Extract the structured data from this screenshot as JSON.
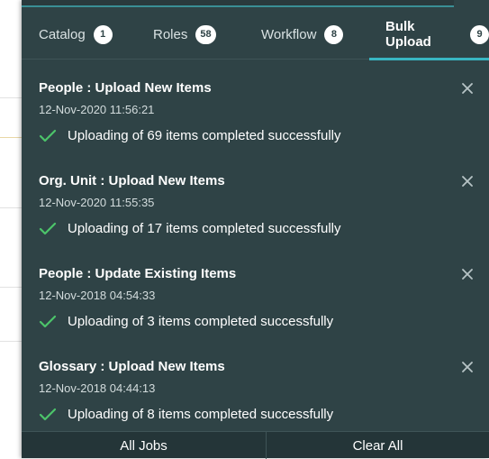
{
  "tabs": [
    {
      "label": "Catalog",
      "count": "1",
      "active": false
    },
    {
      "label": "Roles",
      "count": "58",
      "active": false
    },
    {
      "label": "Workflow",
      "count": "8",
      "active": false
    },
    {
      "label": "Bulk Upload",
      "count": "9",
      "active": true
    }
  ],
  "jobs": [
    {
      "title": "People : Upload New Items",
      "timestamp": "12-Nov-2020 11:56:21",
      "status": "Uploading of 69 items completed successfully"
    },
    {
      "title": "Org. Unit : Upload New Items",
      "timestamp": "12-Nov-2020 11:55:35",
      "status": "Uploading of 17 items completed successfully"
    },
    {
      "title": "People : Update Existing Items",
      "timestamp": "12-Nov-2018 04:54:33",
      "status": "Uploading of 3 items completed successfully"
    },
    {
      "title": "Glossary : Upload New Items",
      "timestamp": "12-Nov-2018 04:44:13",
      "status": "Uploading of 8 items completed successfully"
    }
  ],
  "footer": {
    "all_jobs_label": "All Jobs",
    "clear_all_label": "Clear All"
  },
  "colors": {
    "panel": "#2f4346",
    "accent": "#38b6c2",
    "check": "#4cc46a"
  },
  "icons": {
    "close": "close-icon",
    "status": "check-icon"
  }
}
